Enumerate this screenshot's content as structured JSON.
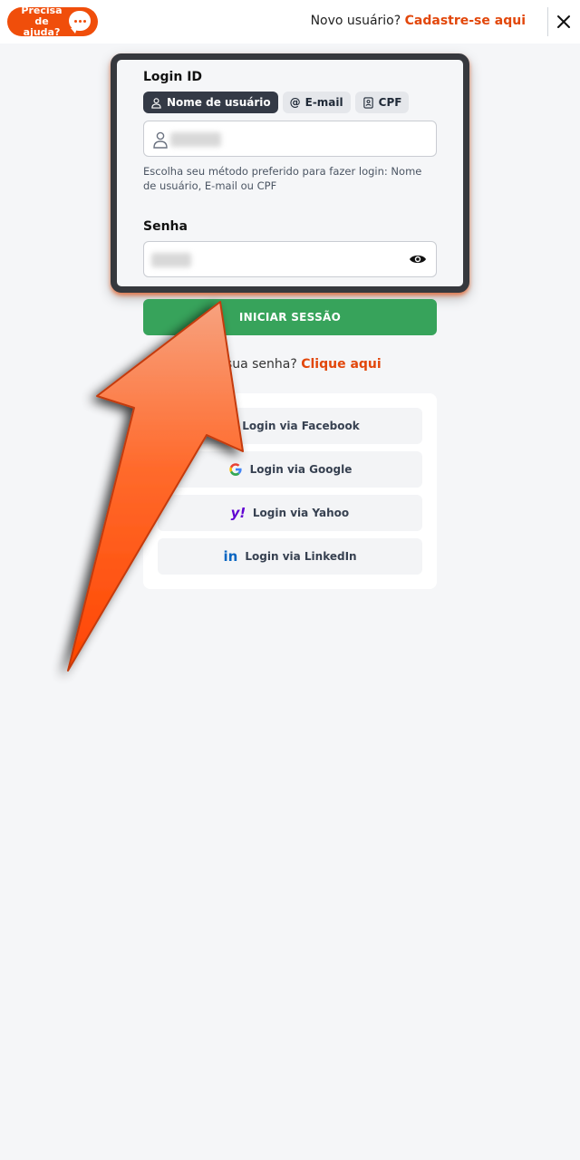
{
  "header": {
    "help_label": "Precisa de\najuda?",
    "new_user_text": "Novo usuário?",
    "signup_link": "Cadastre-se aqui"
  },
  "login": {
    "login_id_label": "Login ID",
    "tabs": [
      {
        "label": "Nome de usuário",
        "active": true
      },
      {
        "label": "E-mail",
        "active": false
      },
      {
        "label": "CPF",
        "active": false
      }
    ],
    "hint": "Escolha seu método preferido para fazer login: Nome de usuário, E-mail ou CPF",
    "password_label": "Senha",
    "submit_label": "INICIAR SESSÃO",
    "forgot_text": "ceu sua senha?",
    "forgot_link": "Clique aqui"
  },
  "social": {
    "facebook": "Login via Facebook",
    "google": "Login via Google",
    "yahoo": "Login via Yahoo",
    "linkedin": "Login via LinkedIn"
  },
  "colors": {
    "accent": "#f04e0b",
    "link": "#e2470b",
    "primary_button": "#37a35b",
    "active_tab": "#343a46",
    "arrow": "#ff5a1f"
  }
}
